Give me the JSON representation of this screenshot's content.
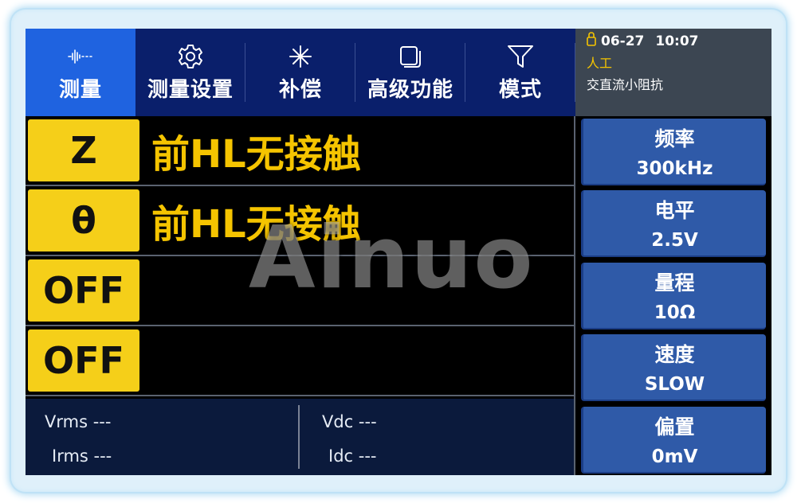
{
  "tabs": [
    {
      "label": "测量",
      "icon": "waveform-icon",
      "active": true
    },
    {
      "label": "测量设置",
      "icon": "gear-icon",
      "active": false
    },
    {
      "label": "补偿",
      "icon": "asterisk-icon",
      "active": false
    },
    {
      "label": "高级功能",
      "icon": "layers-icon",
      "active": false
    },
    {
      "label": "模式",
      "icon": "filter-icon",
      "active": false
    }
  ],
  "status": {
    "date": "06-27",
    "time": "10:07",
    "trigger_mode": "人工",
    "function": "交直流小阻抗"
  },
  "rows": [
    {
      "param": "Z",
      "value": "前HL无接触"
    },
    {
      "param": "θ",
      "value": "前HL无接触"
    },
    {
      "param": "OFF",
      "value": ""
    },
    {
      "param": "OFF",
      "value": ""
    }
  ],
  "readouts": {
    "vrms": "Vrms ---",
    "irms": "Irms ---",
    "vdc": "Vdc ---",
    "idc": "Idc ---"
  },
  "softkeys": [
    {
      "label": "频率",
      "value": "300kHz"
    },
    {
      "label": "电平",
      "value": "2.5V"
    },
    {
      "label": "量程",
      "value": "10Ω"
    },
    {
      "label": "速度",
      "value": "SLOW"
    },
    {
      "label": "偏置",
      "value": "0mV"
    }
  ],
  "watermark": "Ainuo",
  "colors": {
    "accent_yellow": "#f5c400",
    "tab_bar": "#0a1f6b",
    "active_tab": "#1f63e0",
    "softkey": "#2f5aa8"
  }
}
